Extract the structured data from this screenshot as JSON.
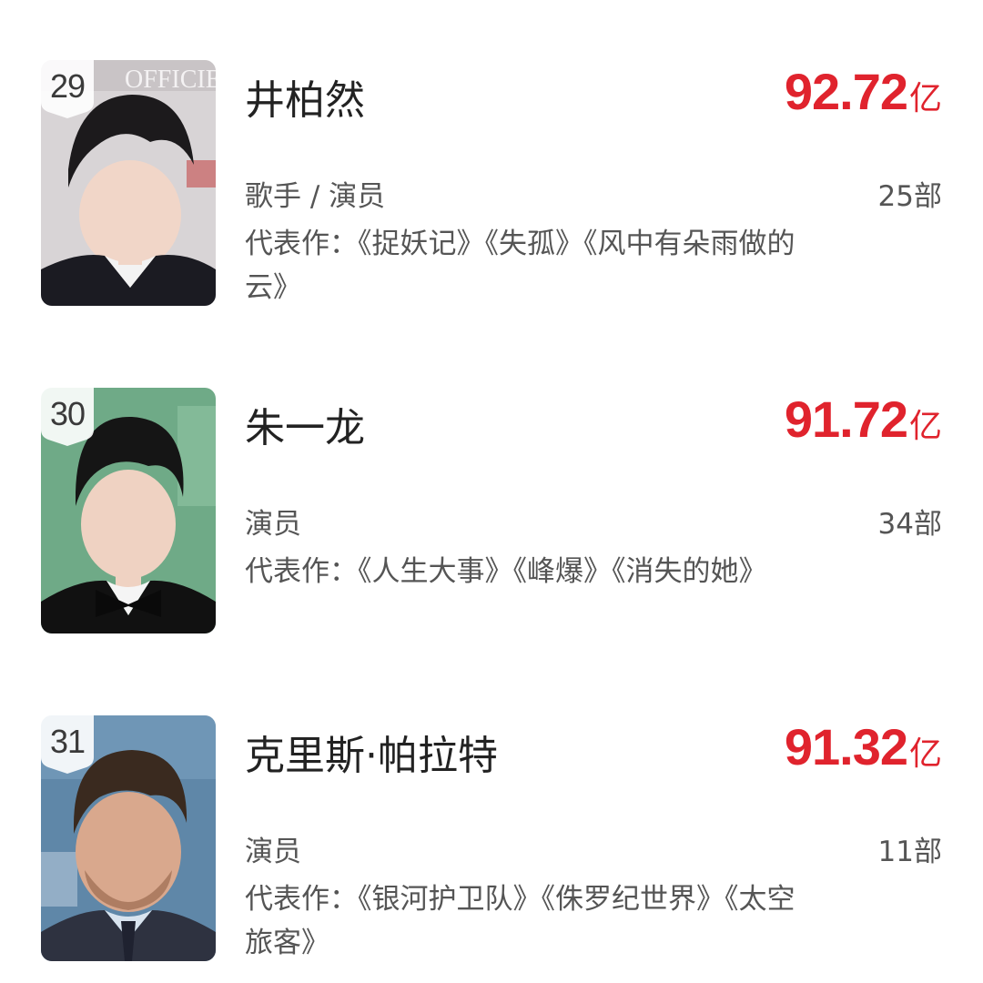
{
  "ranking": {
    "items": [
      {
        "rank": "29",
        "name": "井柏然",
        "box_office": "92.72",
        "unit": "亿",
        "role": "歌手 / 演员",
        "film_count": "25部",
        "works": "代表作：《捉妖记》《失孤》《风中有朵雨做的云》",
        "photo_text": "OFFICIEL",
        "photo_bg": "#d8d4d6",
        "hair": "#1c1a1c",
        "suit": "#1b1b22"
      },
      {
        "rank": "30",
        "name": "朱一龙",
        "box_office": "91.72",
        "unit": "亿",
        "role": "演员",
        "film_count": "34部",
        "works": "代表作：《人生大事》《峰爆》《消失的她》",
        "photo_bg": "#6faa87",
        "hair": "#151515",
        "suit": "#111111"
      },
      {
        "rank": "31",
        "name": "克里斯·帕拉特",
        "box_office": "91.32",
        "unit": "亿",
        "role": "演员",
        "film_count": "11部",
        "works": "代表作：《银河护卫队》《侏罗纪世界》《太空旅客》",
        "photo_bg": "#5f87a8",
        "hair": "#3a2a1f",
        "suit": "#2e3240"
      }
    ]
  }
}
